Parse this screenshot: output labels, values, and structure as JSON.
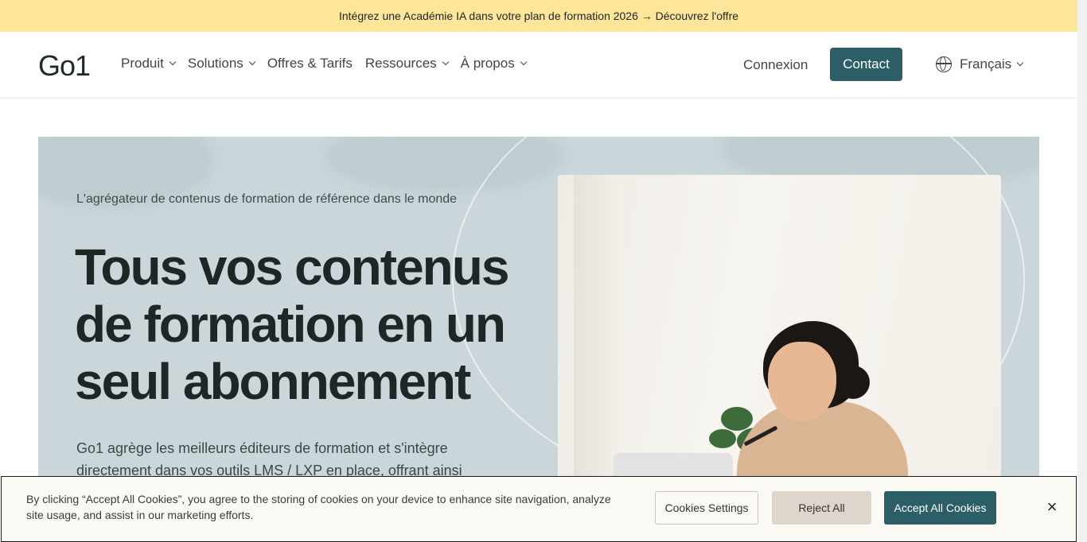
{
  "promo": {
    "text": "Intégrez une Académie IA dans votre plan de formation 2026 → Découvrez l'offre"
  },
  "header": {
    "logo": "Go1",
    "nav": [
      "Produit",
      "Solutions",
      "Offres & Tarifs",
      "Ressources",
      "À propos"
    ],
    "login": "Connexion",
    "contact": "Contact",
    "language": "Français"
  },
  "hero": {
    "eyebrow": "L'agrégateur de contenus de formation de référence dans le monde",
    "title_line1": "Tous vos contenus",
    "title_line2": "de formation en un",
    "title_line3": "seul abonnement",
    "body": "Go1 agrège les meilleurs éditeurs de formation et s'intègre directement dans vos outils LMS / LXP en place, offrant ainsi"
  },
  "cookie": {
    "text": "By clicking “Accept All Cookies”, you agree to the storing of cookies on your device to enhance site navigation, analyze site usage, and assist in our marketing efforts.",
    "settings": "Cookies Settings",
    "reject": "Reject All",
    "accept": "Accept All Cookies",
    "close": "×"
  },
  "colors": {
    "promo_bg": "#fde59a",
    "brand": "#2c5e66",
    "hero_bg": "#cad6da"
  }
}
